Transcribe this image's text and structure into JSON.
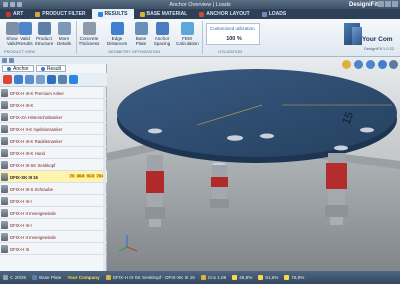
{
  "window": {
    "title_center": "Anchor Overview | Loads",
    "title_right": "DesigniFit"
  },
  "tabs": [
    {
      "label": "ART",
      "color": "#c0392b"
    },
    {
      "label": "PRODUCT FILTER",
      "color": "#d9a23c"
    },
    {
      "label": "RESULTS",
      "color": "#2e86de"
    },
    {
      "label": "BASE MATERIAL",
      "color": "#e0b13a"
    },
    {
      "label": "ANCHOR LAYOUT",
      "color": "#c94b3a"
    },
    {
      "label": "LOADS",
      "color": "#6b8eb6"
    }
  ],
  "ribbon": {
    "buttons": [
      {
        "label": "Show Valid",
        "icon": "show-valid-icon",
        "color": "#7c8fa6"
      },
      {
        "label": "Valid Results",
        "icon": "valid-results-icon",
        "color": "#4f85c9"
      },
      {
        "label": "Product Structure",
        "icon": "product-structure-icon",
        "color": "#5c7ea8"
      },
      {
        "label": "More Details",
        "icon": "more-details-icon",
        "color": "#7b98b8"
      },
      {
        "label": "Concrete Thickness",
        "icon": "concrete-thickness-icon",
        "color": "#8d9aa7"
      },
      {
        "label": "Edge Distances",
        "icon": "edge-distances-icon",
        "color": "#3f7fd0"
      },
      {
        "label": "Base Plate",
        "icon": "base-plate-icon",
        "color": "#6a8fba"
      },
      {
        "label": "Anchor Spacing",
        "icon": "anchor-spacing-icon",
        "color": "#4a7cc0"
      },
      {
        "label": "FEM Calculation",
        "icon": "fem-calculation-icon",
        "color": "#5aa7d8"
      }
    ],
    "groups": {
      "product_view": "PRODUCT VIEW",
      "optimization": "GEOMETRY OPTIMIZATION",
      "utilization": "UTILIZATION"
    },
    "utilization_label": "Customized utilization",
    "utilization_value": "100 %",
    "logo_name": "Your Com",
    "logo_version": "DesigniFit 1.0.22"
  },
  "panel": {
    "tabs": [
      {
        "label": "Anchor"
      },
      {
        "label": "Result"
      }
    ],
    "icon_colors": [
      "#d9463b",
      "#3f7fd0",
      "#5a8fd0",
      "#7aa0c9",
      "#2f6fbf",
      "#5b81ad",
      "#2e86de"
    ],
    "products": [
      {
        "name": "DFIX-H III-K Premium Anker",
        "selected": false
      },
      {
        "name": "DFIX-H III-K",
        "selected": false
      },
      {
        "name": "DFIX-ZA Hinterschnittanker",
        "selected": false
      },
      {
        "name": "DFIX-H II-K Injektionsanker",
        "selected": false
      },
      {
        "name": "DFIX-H III-K Rauklemanker",
        "selected": false
      },
      {
        "name": "DFIX-H III-K Hund",
        "selected": false
      },
      {
        "name": "DFIX-H III-SK Senkkopf",
        "selected": false
      },
      {
        "name": "DFIX-SK III 15",
        "selected": true,
        "util": [
          "70",
          "46.8",
          "91.5",
          "76.8"
        ]
      },
      {
        "name": "DFIX-H III-S Schraube",
        "selected": false
      },
      {
        "name": "DFIX-H III-I",
        "selected": false
      },
      {
        "name": "DFIX-H II Innengewinde",
        "selected": false
      },
      {
        "name": "DFIX-H III-I",
        "selected": false
      },
      {
        "name": "DFIX-H II Innengewinde",
        "selected": false
      },
      {
        "name": "DFIX-H III",
        "selected": false
      }
    ]
  },
  "viewport": {
    "dimension_label": "15",
    "concrete_color": "#8e9396",
    "plate_color": "#2f4b6e"
  },
  "status": {
    "cells": [
      {
        "text": "C 20/25",
        "color": "#8fa0b2"
      },
      {
        "text": "Base Plate",
        "color": "#5c7ea8"
      },
      {
        "text": "Your Company",
        "brand": true
      },
      {
        "text": "DFIX-H III-SK Senkkopf - DFIX-SK III 15",
        "color": "#e0b13a"
      },
      {
        "text": "Cnx 1.89",
        "color": "#e0b13a"
      },
      {
        "text": "46,8%",
        "color": "#ffd84a"
      },
      {
        "text": "91,5%",
        "color": "#ffd84a"
      },
      {
        "text": "76,8%",
        "color": "#ffd84a"
      }
    ]
  }
}
